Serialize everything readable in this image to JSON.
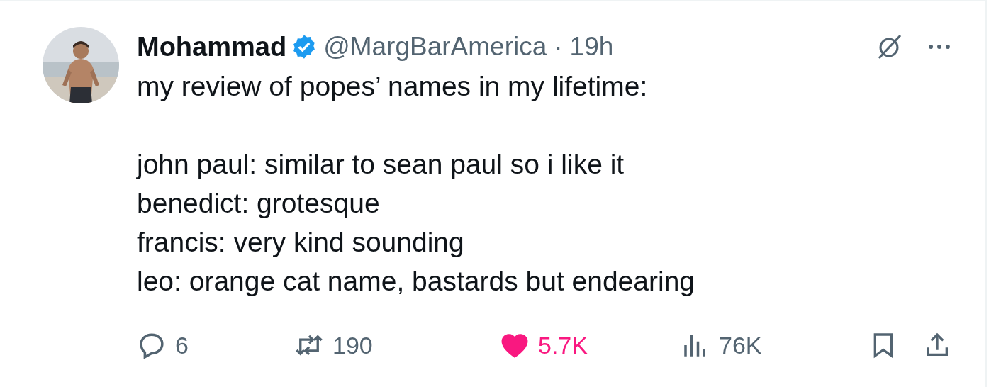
{
  "author": {
    "name": "Mohammad",
    "verified": true,
    "handle": "@MargBarAmerica",
    "separator": "·",
    "time": "19h"
  },
  "paragraphs": [
    [
      "my review of popes’ names in my lifetime:"
    ],
    [
      "john paul: similar to sean paul so i like it",
      "benedict: grotesque",
      "francis: very kind sounding",
      "leo: orange cat name, bastards but endearing"
    ]
  ],
  "actions": [
    {
      "kind": "reply",
      "count": "6",
      "selected": false
    },
    {
      "kind": "repost",
      "count": "190",
      "selected": false
    },
    {
      "kind": "like",
      "count": "5.7K",
      "selected": true
    },
    {
      "kind": "views",
      "count": "76K",
      "selected": false
    }
  ]
}
